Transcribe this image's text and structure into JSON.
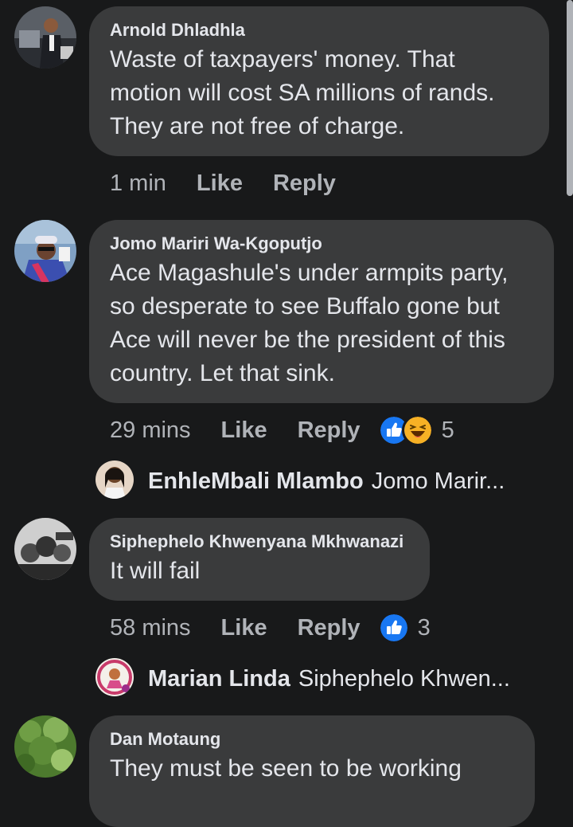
{
  "comments": [
    {
      "author": "Arnold Dhladhla",
      "lines": [
        "Waste of taxpayers' money. That",
        "motion will cost SA millions of rands.",
        "They are not free of charge."
      ],
      "time": "1 min",
      "like": "Like",
      "reply": "Reply"
    },
    {
      "author": "Jomo Mariri Wa-Kgoputjo",
      "lines": [
        "Ace Magashule's under armpits party,",
        "so desperate to see Buffalo gone but",
        "Ace will never be the president of this",
        "country. Let that sink."
      ],
      "time": "29 mins",
      "like": "Like",
      "reply": "Reply",
      "reaction_count": "5",
      "reactions": [
        "like-reaction",
        "haha-reaction"
      ],
      "reply_preview": {
        "name": "EnhleMbali Mlambo",
        "text": "Jomo Marir..."
      }
    },
    {
      "author": "Siphephelo Khwenyana Mkhwanazi",
      "lines": [
        "It will fail"
      ],
      "time": "58 mins",
      "like": "Like",
      "reply": "Reply",
      "reaction_count": "3",
      "reactions": [
        "like-reaction"
      ],
      "reply_preview": {
        "name": "Marian Linda",
        "text": "Siphephelo Khwen..."
      }
    },
    {
      "author": "Dan Motaung",
      "lines": [
        "They must be seen to be working"
      ]
    }
  ],
  "colors": {
    "background": "#18191a",
    "bubble": "#3a3b3c",
    "text": "#e4e6eb",
    "secondary_text": "#b0b3b8",
    "like_blue": "#1877f2",
    "haha_yellow": "#f7b125"
  }
}
